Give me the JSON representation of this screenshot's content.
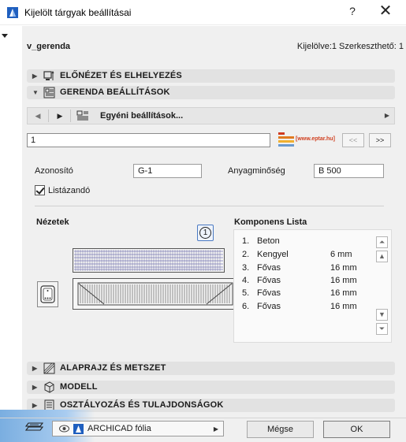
{
  "window": {
    "title": "Kijelölt tárgyak beállításai",
    "help_label": "?",
    "close_label": "✕"
  },
  "selection": {
    "name": "v_gerenda",
    "count_text": "Kijelölve:1 Szerkeszthető: 1"
  },
  "sections": {
    "preview": "ELŐNÉZET ÉS ELHELYEZÉS",
    "beam": "GERENDA BEÁLLÍTÁSOK",
    "plan": "ALAPRAJZ ÉS METSZET",
    "model": "MODELL",
    "classification": "OSZTÁLYOZÁS ÉS TULAJDONSÁGOK"
  },
  "navbar": {
    "prev_label": "◀",
    "next_label": "▶",
    "settings_label": "Egyéni beállítások...",
    "more_label": "▶"
  },
  "id_field": {
    "value": "1"
  },
  "logo": {
    "text": "[www.eptar.hu]"
  },
  "paging": {
    "prev": "<<",
    "next": ">>"
  },
  "params": {
    "id_label": "Azonosító",
    "id_value": "G-1",
    "material_label": "Anyagminőség",
    "material_value": "B 500",
    "listable_label": "Listázandó",
    "listable_checked": true
  },
  "views": {
    "title": "Nézetek",
    "badge": "1"
  },
  "components": {
    "title": "Komponens Lista",
    "rows": [
      {
        "n": "1.",
        "name": "Beton",
        "size": ""
      },
      {
        "n": "2.",
        "name": "Kengyel",
        "size": "6 mm"
      },
      {
        "n": "3.",
        "name": "Fővas",
        "size": "16 mm"
      },
      {
        "n": "4.",
        "name": "Fővas",
        "size": "16 mm"
      },
      {
        "n": "5.",
        "name": "Fővas",
        "size": "16 mm"
      },
      {
        "n": "6.",
        "name": "Fővas",
        "size": "16 mm"
      }
    ],
    "scroll_top": "⏶",
    "scroll_up": "▲",
    "scroll_down": "▼",
    "scroll_bottom": "⏷"
  },
  "footer": {
    "layer_name": "ARCHICAD fólia",
    "cancel": "Mégse",
    "ok": "OK"
  },
  "colors": {
    "accent": "#2f6fd0",
    "section_bg": "#e2e2e2",
    "dialog_bg": "#f0f0f0"
  }
}
